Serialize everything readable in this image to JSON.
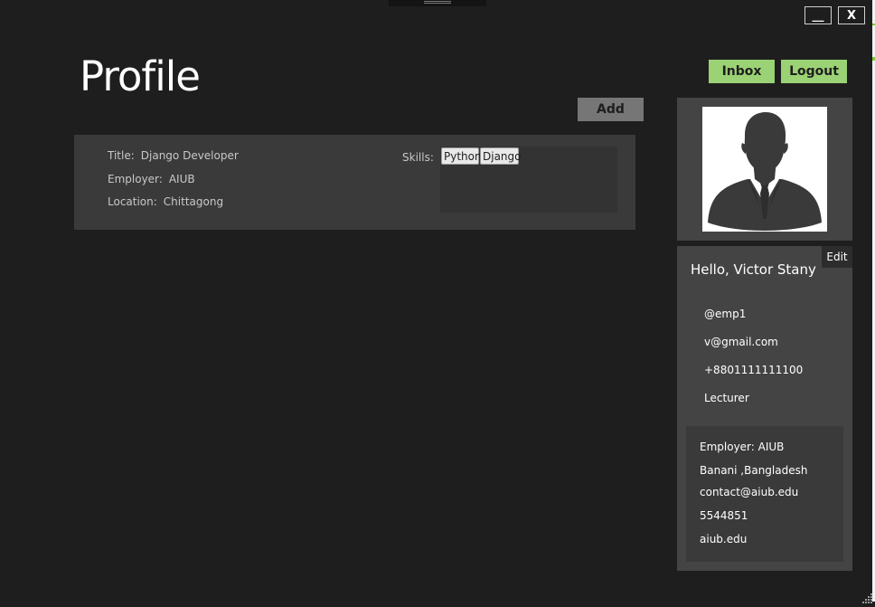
{
  "window": {
    "minimize_label": "__",
    "close_label": "X"
  },
  "page": {
    "title": "Profile"
  },
  "header": {
    "inbox_label": "Inbox",
    "logout_label": "Logout",
    "add_label": "Add"
  },
  "experience": {
    "title_key": "Title:",
    "title_value": "Django Developer",
    "employer_key": "Employer:",
    "employer_value": "AIUB",
    "location_key": "Location:",
    "location_value": "Chittagong",
    "skills_label": "Skills:",
    "skills": [
      "Python",
      "Django"
    ]
  },
  "profile": {
    "edit_label": "Edit",
    "greeting": "Hello, Victor Stany",
    "username": "@emp1",
    "email": "v@gmail.com",
    "phone": "+8801111111100",
    "designation": "Lecturer"
  },
  "employer_info": {
    "name": "Employer: AIUB",
    "address": "Banani ,Bangladesh",
    "email": "contact@aiub.edu",
    "phone": "5544851",
    "website": "aiub.edu"
  },
  "icons": {
    "avatar": "user-silhouette-icon",
    "resize": "resize-grip-icon"
  },
  "colors": {
    "background": "#1e1e1e",
    "accent_green": "#9bd275",
    "panel": "#444444",
    "card": "#3a3a3a"
  }
}
